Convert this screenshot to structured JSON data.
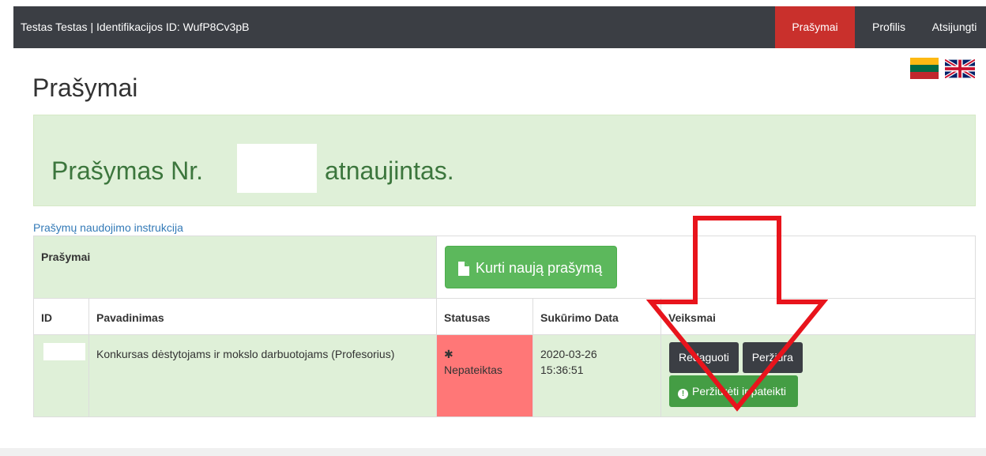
{
  "navbar": {
    "brand": "Testas Testas | Identifikacijos ID: WufP8Cv3pB",
    "items": [
      {
        "label": "Prašymai",
        "active": true
      },
      {
        "label": "Profilis",
        "active": false
      },
      {
        "label": "Atsijungti",
        "active": false
      }
    ],
    "active_color": "#c9302c",
    "background": "#3b3e44"
  },
  "languages": [
    "lithuanian-flag-icon",
    "uk-flag-icon"
  ],
  "page": {
    "title": "Prašymai"
  },
  "alert": {
    "text_before": "Prašymas Nr.",
    "text_after": "atnaujintas."
  },
  "help_link": "Prašymų naudojimo instrukcija",
  "table": {
    "section_label": "Prašymai",
    "create_button": "Kurti naują prašymą",
    "columns": [
      "ID",
      "Pavadinimas",
      "Statusas",
      "Sukūrimo Data",
      "Veiksmai"
    ],
    "rows": [
      {
        "id": "",
        "title": "Konkursas dėstytojams ir mokslo darbuotojams (Profesorius)",
        "status_icon": "✱",
        "status": "Nepateiktas",
        "date": "2020-03-26",
        "time": "15:36:51",
        "actions": {
          "edit": "Redaguoti",
          "view": "Peržiūra",
          "submit": "Peržiūrėti ir pateikti"
        }
      }
    ]
  },
  "colors": {
    "success_bg": "#dff0d8",
    "success_text": "#3c763d",
    "status_bg": "#ff7777",
    "primary_green": "#5cb85c",
    "annotation_red": "#e8141c"
  }
}
